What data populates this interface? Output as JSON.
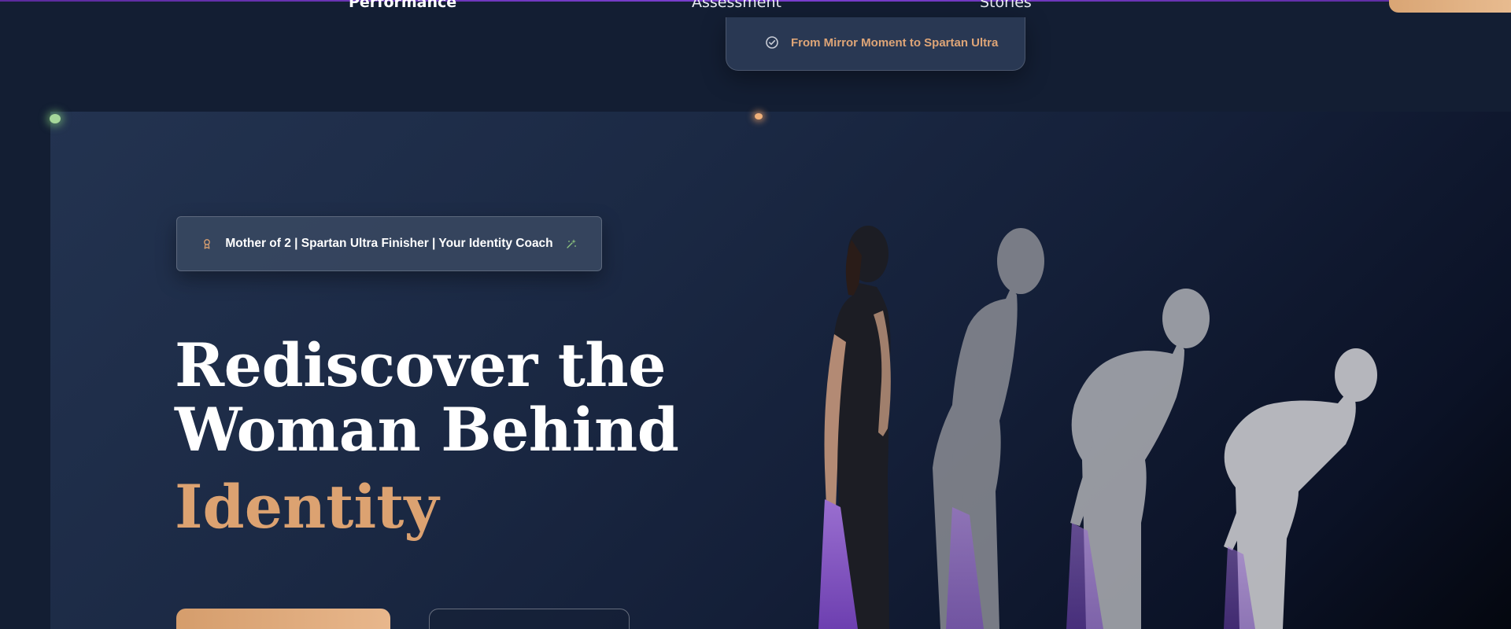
{
  "nav": {
    "items": [
      {
        "label": "Performance"
      },
      {
        "label": "Assessment"
      },
      {
        "label": "Stories"
      }
    ]
  },
  "dropdown": {
    "item_label": "From Mirror Moment to Spartan Ultra",
    "icon": "check-circle-icon"
  },
  "hero": {
    "badge_text": "Mother of 2 | Spartan Ultra Finisher | Your Identity Coach",
    "badge_icons": [
      "ribbon-icon",
      "sparkle-icon"
    ],
    "headline_line1": "Rediscover the",
    "headline_line2": "Woman Behind",
    "headline_accent": "Identity",
    "image": "woman-posture-progression-figures"
  },
  "colors": {
    "accent": "#dca271",
    "background": "#131e33",
    "hero_gradient_start": "#233350",
    "hero_gradient_end": "#04070f",
    "topline": "#7b3fd1"
  }
}
